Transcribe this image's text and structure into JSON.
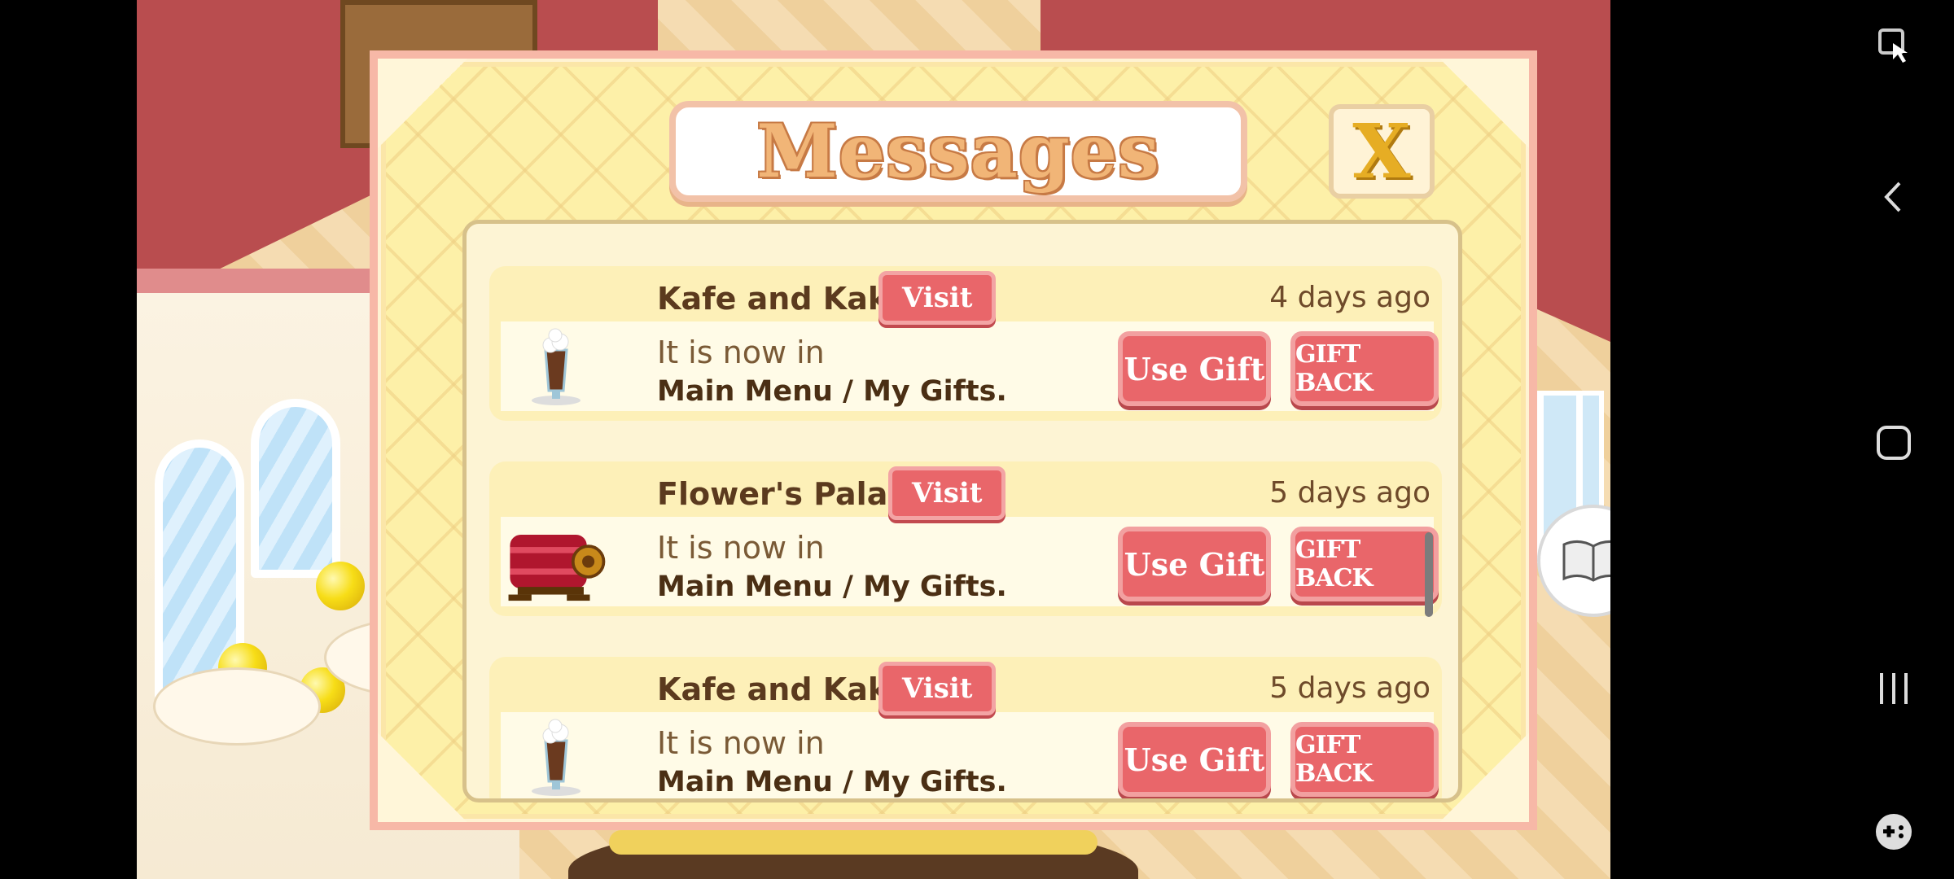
{
  "dialog": {
    "title": "Messages",
    "close_label": "X"
  },
  "messages": [
    {
      "sender": "Kafe and Kake",
      "visit_label": "Visit",
      "time": "4 days ago",
      "line1": "It is now in",
      "line2": "Main Menu / My Gifts.",
      "use_label": "Use Gift",
      "gift_back_label": "GIFT BACK",
      "item_icon": "hot-cocoa-icon"
    },
    {
      "sender": "Flower's Palace",
      "visit_label": "Visit",
      "time": "5 days ago",
      "line1": "It is now in",
      "line2": "Main Menu / My Gifts.",
      "use_label": "Use Gift",
      "gift_back_label": "GIFT BACK",
      "item_icon": "cake-roll-oven-icon"
    },
    {
      "sender": "Kafe and Kake",
      "visit_label": "Visit",
      "time": "5 days ago",
      "line1": "It is now in",
      "line2": "Main Menu / My Gifts.",
      "use_label": "Use Gift",
      "gift_back_label": "GIFT BACK",
      "item_icon": "hot-cocoa-icon"
    }
  ],
  "colors": {
    "button_red": "#e9666a",
    "dialog_yellow": "#fdf0a8",
    "title_orange": "#f1b577",
    "close_gold": "#e6ad24"
  },
  "navbar": {
    "icons": [
      "touch-mode-icon",
      "back-icon",
      "home-icon",
      "recents-icon",
      "game-tools-icon"
    ]
  }
}
